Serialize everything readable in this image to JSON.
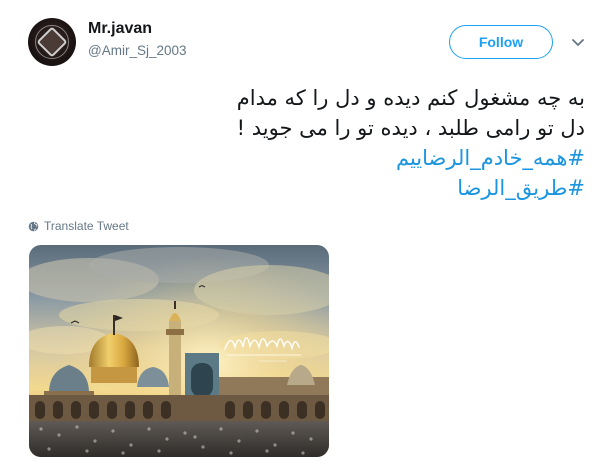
{
  "user": {
    "display_name": "Mr.javan",
    "handle": "@Amir_Sj_2003"
  },
  "actions": {
    "follow_label": "Follow",
    "more_icon": "chevron-down-icon"
  },
  "tweet": {
    "line1": "به چه مشغول کنم دیده و دل را که مدام",
    "line2": "دل تو رامی طلبد ، دیده تو را می جوید !",
    "hashtag1": "#همه_خادم_الرضاییم",
    "hashtag2": "#طریق_الرضا"
  },
  "translate": {
    "label": "Translate Tweet",
    "icon": "globe-icon"
  },
  "media": {
    "calligraphy_text": "السلام علیک یا علی بن موسی الرضا"
  },
  "colors": {
    "accent": "#1da1f2",
    "hashtag": "#1b95e0",
    "secondary_text": "#657786",
    "primary_text": "#14171a"
  }
}
